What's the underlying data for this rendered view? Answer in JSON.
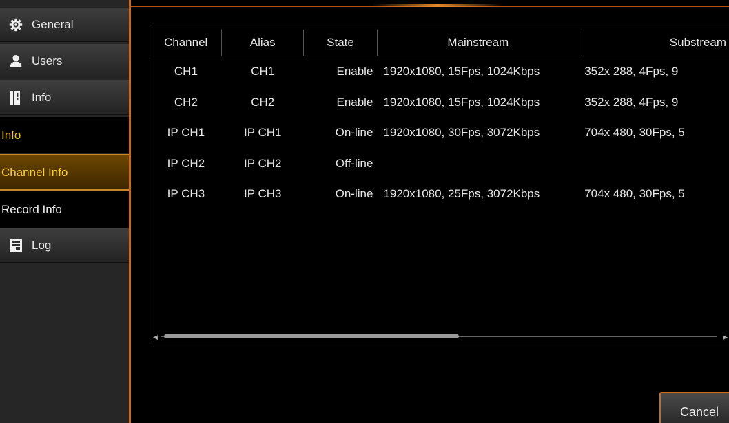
{
  "sidebar": {
    "items": [
      {
        "label": "General",
        "icon": "gear-icon"
      },
      {
        "label": "Users",
        "icon": "user-icon"
      },
      {
        "label": "Info",
        "icon": "info-icon"
      }
    ],
    "sub_items": [
      {
        "label": "Info"
      },
      {
        "label": "Channel Info"
      },
      {
        "label": "Record Info"
      }
    ],
    "log": {
      "label": "Log",
      "icon": "log-icon"
    }
  },
  "table": {
    "headers": [
      "Channel",
      "Alias",
      "State",
      "Mainstream",
      "Substream"
    ],
    "rows": [
      {
        "channel": "CH1",
        "alias": "CH1",
        "state": "Enable",
        "mainstream": "1920x1080, 15Fps,  1024Kbps",
        "substream": "352x 288,  4Fps,  9"
      },
      {
        "channel": "CH2",
        "alias": "CH2",
        "state": "Enable",
        "mainstream": "1920x1080, 15Fps,  1024Kbps",
        "substream": "352x 288,  4Fps,  9"
      },
      {
        "channel": "IP CH1",
        "alias": "IP CH1",
        "state": "On-line",
        "mainstream": "1920x1080, 30Fps,  3072Kbps",
        "substream": "704x 480, 30Fps,  5"
      },
      {
        "channel": "IP CH2",
        "alias": "IP CH2",
        "state": "Off-line",
        "mainstream": "",
        "substream": ""
      },
      {
        "channel": "IP CH3",
        "alias": "IP CH3",
        "state": "On-line",
        "mainstream": "1920x1080, 25Fps,  3072Kbps",
        "substream": "704x 480, 30Fps,  5"
      }
    ]
  },
  "buttons": {
    "cancel": "Cancel"
  },
  "colors": {
    "accent": "#c86a1c",
    "active_text": "#f6cf3a",
    "section_text": "#f0c419"
  }
}
